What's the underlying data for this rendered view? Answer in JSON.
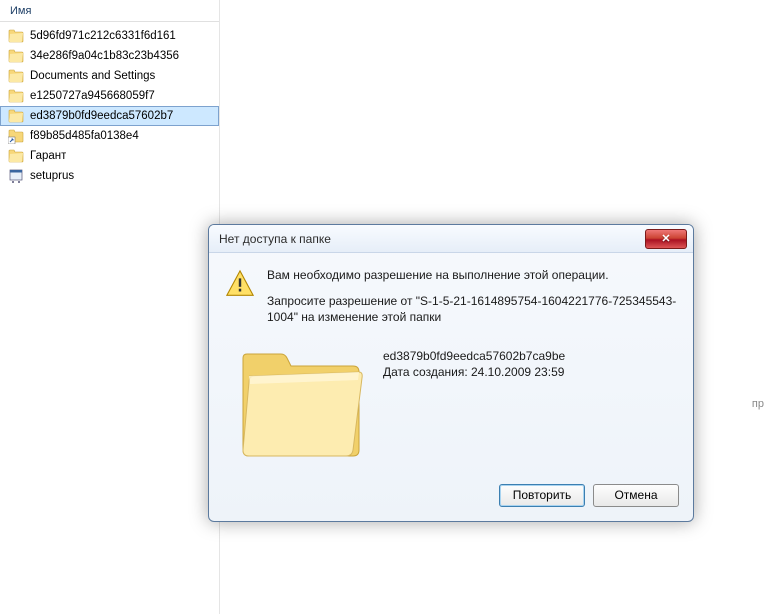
{
  "column_header": "Имя",
  "files": [
    {
      "name": "5d96fd971c212c6331f6d161",
      "type": "folder"
    },
    {
      "name": "34e286f9a04c1b83c23b4356",
      "type": "folder"
    },
    {
      "name": "Documents and Settings",
      "type": "folder"
    },
    {
      "name": "e1250727a945668059f7",
      "type": "folder"
    },
    {
      "name": "ed3879b0fd9eedca57602b7",
      "type": "folder",
      "selected": true
    },
    {
      "name": "f89b85d485fa0138e4",
      "type": "shortcut"
    },
    {
      "name": "Гарант",
      "type": "folder"
    },
    {
      "name": "setuprus",
      "type": "app"
    }
  ],
  "dialog": {
    "title": "Нет доступа к папке",
    "message_line1": "Вам необходимо разрешение на выполнение этой операции.",
    "message_line2": "Запросите разрешение от \"S-1-5-21-1614895754-1604221776-725345543-1004\" на изменение этой папки",
    "folder_name": "ed3879b0fd9eedca57602b7ca9be",
    "created_label": "Дата создания: 24.10.2009 23:59",
    "retry": "Повторить",
    "cancel": "Отмена"
  },
  "side_text": "пр"
}
